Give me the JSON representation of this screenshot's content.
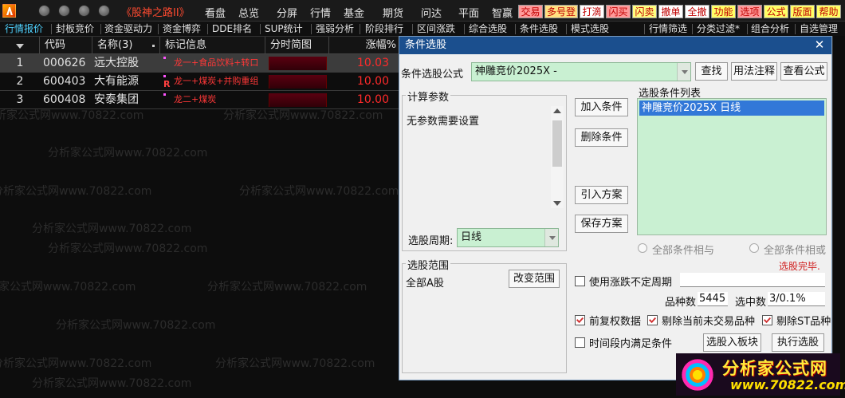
{
  "app": {
    "title": "《股神之路II》",
    "menu": [
      "看盘",
      "总览",
      "分屏",
      "行情",
      "基金",
      "期货",
      "问达",
      "平面",
      "智赢"
    ],
    "highlight_buttons": [
      {
        "label": "交易",
        "bg": "#ff9a9a"
      },
      {
        "label": "多号登",
        "bg": "#ffe080"
      },
      {
        "label": "打滴",
        "bg": "#ffffff"
      },
      {
        "label": "闪买",
        "bg": "#ff9a9a"
      },
      {
        "label": "闪卖",
        "bg": "#ffff80"
      },
      {
        "label": "撤单",
        "bg": "#ffffff"
      },
      {
        "label": "全撤",
        "bg": "#ffffff"
      },
      {
        "label": "功能",
        "bg": "#ffff66"
      },
      {
        "label": "选项",
        "bg": "#ff9a9a"
      },
      {
        "label": "公式",
        "bg": "#ffff66"
      },
      {
        "label": "版面",
        "bg": "#ffff66"
      },
      {
        "label": "帮助",
        "bg": "#ffff66"
      }
    ]
  },
  "toolbar": {
    "items": [
      "行情报价",
      "封板竞价",
      "资金驱动力",
      "资金博弈",
      "DDE排名",
      "SUP统计",
      "强弱分析",
      "阶段排行",
      "区间涨跌",
      "综合选股",
      "条件选股",
      "模式选股",
      "行情筛选",
      "分类过滤*",
      "组合分析",
      "自选管理"
    ]
  },
  "table": {
    "headers": {
      "code": "代码",
      "name": "名称(3)",
      "tag": "标记信息",
      "spark": "分时简图",
      "pct": "涨幅%"
    },
    "rows": [
      {
        "idx": "1",
        "code": "000626",
        "name": "远大控股",
        "tag": "龙一+食品饮料+转口",
        "r": false,
        "pct": "10.03",
        "selected": true
      },
      {
        "idx": "2",
        "code": "600403",
        "name": "大有能源",
        "tag": "龙一+煤炭+并购重组",
        "r": true,
        "pct": "10.00",
        "selected": false
      },
      {
        "idx": "3",
        "code": "600408",
        "name": "安泰集团",
        "tag": "龙二+煤炭",
        "r": false,
        "pct": "10.00",
        "selected": false
      }
    ]
  },
  "watermark": "分析家公式网www.70822.com",
  "dialog": {
    "title": "条件选股",
    "formula_label": "条件选股公式",
    "formula_value": "神雕竞价2025X  -",
    "btn_find": "查找",
    "btn_usage": "用法注释",
    "btn_view": "查看公式",
    "params_title": "计算参数",
    "params_text": "无参数需要设置",
    "period_label": "选股周期:",
    "period_value": "日线",
    "btn_add": "加入条件",
    "btn_delete": "删除条件",
    "btn_import": "引入方案",
    "btn_save": "保存方案",
    "cond_list_title": "选股条件列表",
    "cond_item": "神雕竞价2025X  日线",
    "radio_and": "全部条件相与",
    "radio_or": "全部条件相或",
    "status": "选股完毕.",
    "scope_title": "选股范围",
    "scope_value": "全部A股",
    "btn_change_scope": "改变范围",
    "chk_period": "使用涨跌不定周期",
    "count_label": "品种数",
    "count_value": "5445",
    "selected_label": "选中数",
    "selected_value": "3/0.1%",
    "chk_fq": "前复权数据",
    "chk_untraded": "剔除当前未交易品种",
    "chk_st": "剔除ST品种",
    "chk_time": "时间段内满足条件",
    "btn_to_block": "选股入板块",
    "btn_execute": "执行选股"
  },
  "logo": {
    "name": "分析家公式网",
    "url": "www.70822.com"
  }
}
